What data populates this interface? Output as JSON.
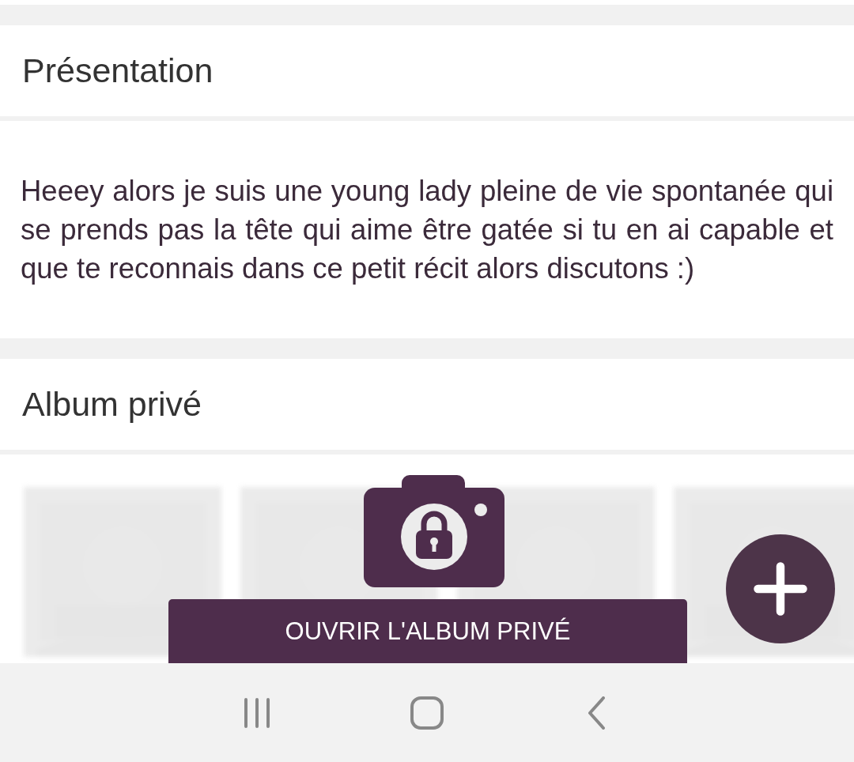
{
  "presentation": {
    "title": "Présentation",
    "text": "Heeey alors je suis une young lady pleine de vie spontanée qui se prends pas la tête qui aime être gatée si tu en ai capable et que te reconnais dans ce petit récit alors discutons :)"
  },
  "private_album": {
    "title": "Album privé",
    "button": "OUVRIR L'ALBUM PRIVÉ"
  }
}
